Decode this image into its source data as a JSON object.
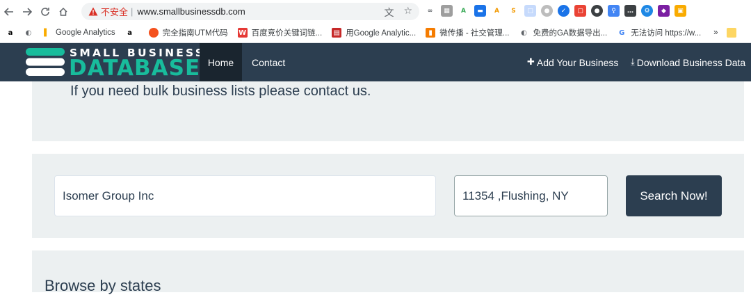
{
  "browser": {
    "security_label": "不安全",
    "url": "www.smallbusinessdb.com",
    "bookmarks": [
      {
        "icon": "amazon-icon",
        "label": ""
      },
      {
        "icon": "globe-icon",
        "label": ""
      },
      {
        "icon": "google-analytics-icon",
        "label": "Google Analytics"
      },
      {
        "icon": "amazon-icon",
        "label": ""
      },
      {
        "icon": "orange-circle-icon",
        "label": "完全指南UTM代码"
      },
      {
        "icon": "w-icon",
        "label": "百度竞价关键词链..."
      },
      {
        "icon": "red-square-icon",
        "label": "用Google Analytic..."
      },
      {
        "icon": "orange-square-icon",
        "label": "微传播 - 社交管理..."
      },
      {
        "icon": "globe-icon",
        "label": "免费的GA数据导出..."
      },
      {
        "icon": "google-g-icon",
        "label": "无法访问 https://w..."
      }
    ],
    "more_label": "»"
  },
  "site": {
    "logo_top": "SMALL BUSINESS",
    "logo_bottom": "DATABASE",
    "nav": {
      "home": "Home",
      "contact": "Contact",
      "add_business": "Add Your Business",
      "download": "Download Business Data"
    }
  },
  "content": {
    "bulk_text": "If you need bulk business lists please contact us.",
    "search": {
      "business_value": "Isomer Group Inc",
      "location_value": "11354 ,Flushing, NY",
      "button_label": "Search Now!"
    },
    "browse_text": "Browse by states"
  },
  "colors": {
    "navbar": "#2c3e50",
    "home_active": "#1a252f",
    "accent": "#18bc9c",
    "panel": "#ecf0f1"
  }
}
